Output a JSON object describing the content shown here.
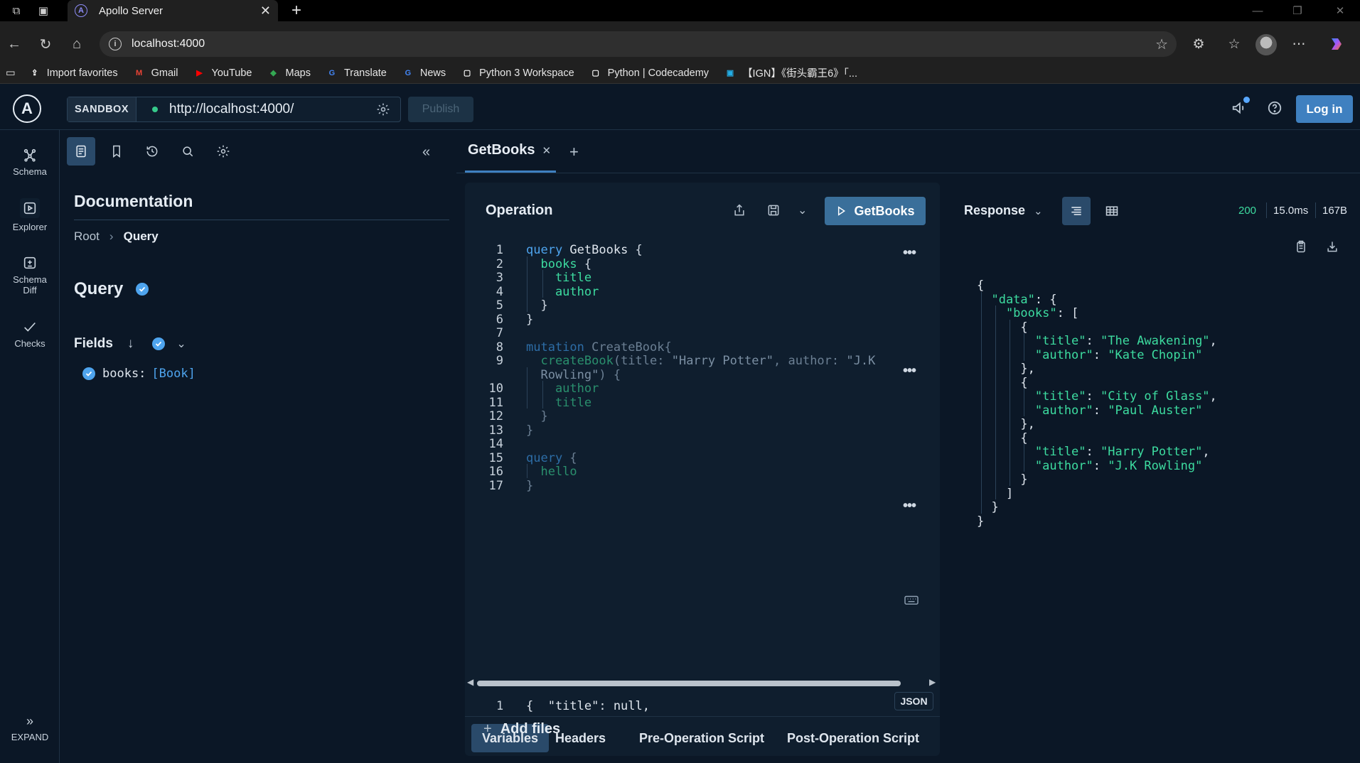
{
  "browser": {
    "tab_title": "Apollo Server",
    "url": "localhost:4000",
    "bookmarks": [
      {
        "label": "Import favorites",
        "icon": "import-icon"
      },
      {
        "label": "Gmail",
        "icon": "gmail-icon",
        "color": "#ea4335"
      },
      {
        "label": "YouTube",
        "icon": "youtube-icon",
        "color": "#ff0000"
      },
      {
        "label": "Maps",
        "icon": "maps-icon",
        "color": "#34a853"
      },
      {
        "label": "Translate",
        "icon": "translate-icon",
        "color": "#4285f4"
      },
      {
        "label": "News",
        "icon": "news-icon",
        "color": "#4285f4"
      },
      {
        "label": "Python 3 Workspace",
        "icon": "page-icon"
      },
      {
        "label": "Python | Codecademy",
        "icon": "page-icon"
      },
      {
        "label": "【IGN】《街头霸王6》「...",
        "icon": "bilibili-icon",
        "color": "#23ade5"
      }
    ]
  },
  "topnav": {
    "sandbox_label": "SANDBOX",
    "endpoint": "http://localhost:4000/",
    "publish_label": "Publish",
    "login_label": "Log in",
    "logo_letter": "A"
  },
  "leftnav": {
    "items": [
      {
        "label": "Schema",
        "icon": "schema-icon"
      },
      {
        "label": "Explorer",
        "icon": "explorer-icon"
      },
      {
        "label": "Schema Diff",
        "icon": "schema-diff-icon"
      },
      {
        "label": "Checks",
        "icon": "checkmark-icon"
      }
    ],
    "expand_label": "EXPAND"
  },
  "docs": {
    "title": "Documentation",
    "breadcrumb": [
      "Root",
      "Query"
    ],
    "heading": "Query",
    "fields_label": "Fields",
    "fields": [
      {
        "name": "books:",
        "type": "[Book]"
      }
    ]
  },
  "operation": {
    "tab_label": "GetBooks",
    "panel_title": "Operation",
    "run_label": "GetBooks",
    "variable_tabs": [
      "Variables",
      "Headers",
      "Pre-Operation Script",
      "Post-Operation Script"
    ],
    "variables_line_no": "1",
    "variables_line": "{  \"title\": null,",
    "format_badge": "JSON",
    "add_files_label": "Add files",
    "code_lines": [
      {
        "n": "1",
        "seg": [
          [
            "kw",
            "query"
          ],
          [
            "fn",
            " GetBooks"
          ],
          [
            "pun",
            " {"
          ]
        ]
      },
      {
        "n": "2",
        "seg": [
          [
            "fld",
            "  books"
          ],
          [
            "pun",
            " {"
          ]
        ]
      },
      {
        "n": "3",
        "seg": [
          [
            "fld",
            "    title"
          ]
        ]
      },
      {
        "n": "4",
        "seg": [
          [
            "fld",
            "    author"
          ]
        ]
      },
      {
        "n": "5",
        "seg": [
          [
            "pun",
            "  }"
          ]
        ]
      },
      {
        "n": "6",
        "seg": [
          [
            "pun",
            "}"
          ]
        ]
      },
      {
        "n": "7",
        "seg": []
      },
      {
        "n": "8",
        "seg": [
          [
            "kw-dim",
            "mutation"
          ],
          [
            "fn-dim",
            " CreateBook{"
          ]
        ]
      },
      {
        "n": "9",
        "seg": [
          [
            "fld-dim",
            "  createBook"
          ],
          [
            "pun-dim",
            "(title: "
          ],
          [
            "str-dim",
            "\"Harry Potter\""
          ],
          [
            "pun-dim",
            ", author: "
          ],
          [
            "str-dim",
            "\"J.K"
          ]
        ]
      },
      {
        "n": "",
        "seg": [
          [
            "str-dim",
            "  Rowling\""
          ],
          [
            "pun-dim",
            ") {"
          ]
        ]
      },
      {
        "n": "10",
        "seg": [
          [
            "fld-dim",
            "    author"
          ]
        ]
      },
      {
        "n": "11",
        "seg": [
          [
            "fld-dim",
            "    title"
          ]
        ]
      },
      {
        "n": "12",
        "seg": [
          [
            "pun-dim",
            "  }"
          ]
        ]
      },
      {
        "n": "13",
        "seg": [
          [
            "pun-dim",
            "}"
          ]
        ]
      },
      {
        "n": "14",
        "seg": []
      },
      {
        "n": "15",
        "seg": [
          [
            "kw-dim",
            "query"
          ],
          [
            "pun-dim",
            " {"
          ]
        ]
      },
      {
        "n": "16",
        "seg": [
          [
            "fld-dim",
            "  hello"
          ]
        ]
      },
      {
        "n": "17",
        "seg": [
          [
            "pun-dim",
            "}"
          ]
        ]
      }
    ]
  },
  "response": {
    "title": "Response",
    "status": "200",
    "time": "15.0ms",
    "size": "167B",
    "json_lines": [
      [
        [
          "jp",
          "{"
        ]
      ],
      [
        [
          "jkey",
          "  \"data\""
        ],
        [
          "jp",
          ": {"
        ]
      ],
      [
        [
          "jkey",
          "    \"books\""
        ],
        [
          "jp",
          ": ["
        ]
      ],
      [
        [
          "jp",
          "      {"
        ]
      ],
      [
        [
          "jkey",
          "        \"title\""
        ],
        [
          "jp",
          ": "
        ],
        [
          "jstr",
          "\"The Awakening\""
        ],
        [
          "jp",
          ","
        ]
      ],
      [
        [
          "jkey",
          "        \"author\""
        ],
        [
          "jp",
          ": "
        ],
        [
          "jstr",
          "\"Kate Chopin\""
        ]
      ],
      [
        [
          "jp",
          "      },"
        ]
      ],
      [
        [
          "jp",
          "      {"
        ]
      ],
      [
        [
          "jkey",
          "        \"title\""
        ],
        [
          "jp",
          ": "
        ],
        [
          "jstr",
          "\"City of Glass\""
        ],
        [
          "jp",
          ","
        ]
      ],
      [
        [
          "jkey",
          "        \"author\""
        ],
        [
          "jp",
          ": "
        ],
        [
          "jstr",
          "\"Paul Auster\""
        ]
      ],
      [
        [
          "jp",
          "      },"
        ]
      ],
      [
        [
          "jp",
          "      {"
        ]
      ],
      [
        [
          "jkey",
          "        \"title\""
        ],
        [
          "jp",
          ": "
        ],
        [
          "jstr",
          "\"Harry Potter\""
        ],
        [
          "jp",
          ","
        ]
      ],
      [
        [
          "jkey",
          "        \"author\""
        ],
        [
          "jp",
          ": "
        ],
        [
          "jstr",
          "\"J.K Rowling\""
        ]
      ],
      [
        [
          "jp",
          "      }"
        ]
      ],
      [
        [
          "jp",
          "    ]"
        ]
      ],
      [
        [
          "jp",
          "  }"
        ]
      ],
      [
        [
          "jp",
          "}"
        ]
      ]
    ]
  },
  "colors": {
    "accent": "#3f80c0",
    "field": "#3ddca0",
    "keyword": "#4ea4ee",
    "background": "#0b1726"
  }
}
